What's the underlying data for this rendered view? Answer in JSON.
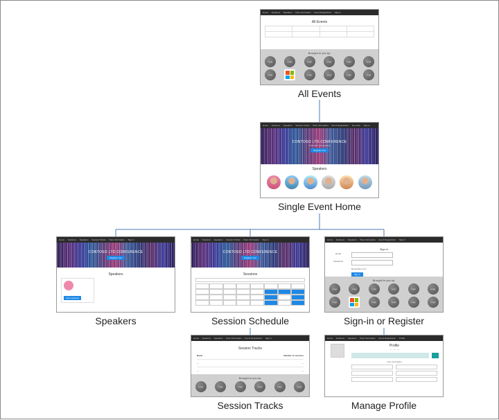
{
  "diagram": {
    "hero": {
      "title": "CONTOSO LTD CONFERENCE",
      "subtitle": "6.24.2019 | Amsterdam",
      "register_btn": "Register now"
    },
    "nav_items": [
      "Home",
      "Sessions",
      "Speakers",
      "Session Tracks",
      "Pass Information",
      "Event Registration",
      "My Links",
      "Sign in"
    ],
    "sponsor_title": "Brought to you by:",
    "logo_text": "Logo",
    "nodes": {
      "all_events": {
        "label": "All Events",
        "page_title": "All Events"
      },
      "single_event": {
        "label": "Single Event Home",
        "section": "Speakers"
      },
      "speakers": {
        "label": "Speakers",
        "section": "Speakers",
        "btn": "View sessions"
      },
      "schedule": {
        "label": "Session Schedule",
        "section": "Sessions"
      },
      "signin": {
        "label": "Sign-in or Register",
        "page_title": "Sign in",
        "email_lbl": "Email",
        "pwd_lbl": "Password",
        "remember": "Remember me?",
        "btn": "Sign in"
      },
      "tracks": {
        "label": "Session Tracks",
        "page_title": "Session Tracks",
        "col_name": "Name",
        "col_sessions": "Number of sessions"
      },
      "profile": {
        "label": "Manage Profile",
        "page_title": "Profile",
        "info": "Your information",
        "banner": "Please complete your profile so we can better serve you."
      }
    }
  }
}
